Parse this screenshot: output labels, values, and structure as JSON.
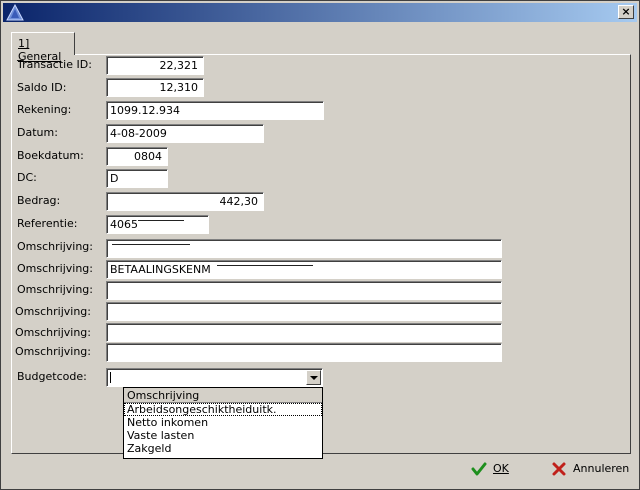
{
  "window": {
    "close_glyph": "×",
    "icon": "triangle-icon"
  },
  "tabs": [
    {
      "label": "1] General"
    }
  ],
  "fields": {
    "transactie_id": {
      "label": "Transactie ID:",
      "value": "22,321"
    },
    "saldo_id": {
      "label": "Saldo ID:",
      "value": "12,310"
    },
    "rekening": {
      "label": "Rekening:",
      "value": "1099.12.934"
    },
    "datum": {
      "label": "Datum:",
      "value": "4-08-2009"
    },
    "boekdatum": {
      "label": "Boekdatum:",
      "value": "0804"
    },
    "dc": {
      "label": "DC:",
      "value": "D"
    },
    "bedrag": {
      "label": "Bedrag:",
      "value": "442,30"
    },
    "referentie": {
      "label": "Referentie:",
      "value": "4065"
    },
    "omschrijving_label": "Omschrijving:",
    "omschrijving_1": "",
    "omschrijving_2": "BETAALINGSKENM",
    "budgetcode": {
      "label": "Budgetcode:",
      "value": ""
    }
  },
  "dropdown": {
    "header": "Omschrijving",
    "options": [
      "Arbeidsongeschiktheiduitk.",
      "Netto inkomen",
      "Vaste lasten",
      "Zakgeld"
    ],
    "selected": "Arbeidsongeschiktheiduitk."
  },
  "buttons": {
    "ok": {
      "label": "OK",
      "icon": "check-icon",
      "icon_color": "#1e8f1e"
    },
    "annuleren": {
      "label": "Annuleren",
      "icon": "x-icon",
      "icon_color": "#c0201a"
    }
  }
}
